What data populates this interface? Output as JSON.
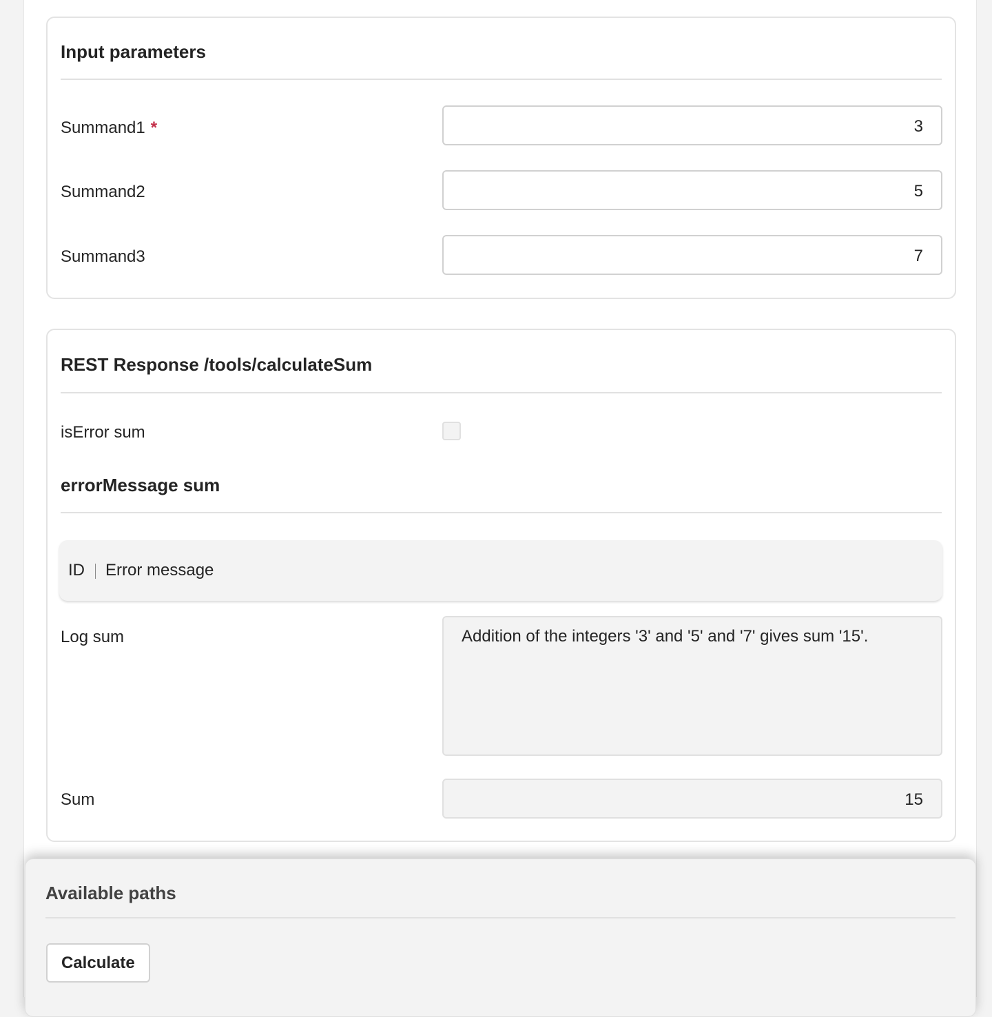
{
  "input_parameters": {
    "title": "Input parameters",
    "fields": [
      {
        "label": "Summand1",
        "required_mark": "*",
        "value": "3"
      },
      {
        "label": "Summand2",
        "value": "5"
      },
      {
        "label": "Summand3",
        "value": "7"
      }
    ]
  },
  "rest_response": {
    "title": "REST Response /tools/calculateSum",
    "is_error_label": "isError sum",
    "is_error_checked": false,
    "error_message_title": "errorMessage sum",
    "error_table": {
      "columns": [
        "ID",
        "Error message"
      ]
    },
    "log_label": "Log sum",
    "log_value": "Addition of the integers '3' and '5' and '7' gives sum '15'.",
    "sum_label": "Sum",
    "sum_value": "15"
  },
  "footer": {
    "title": "Available paths",
    "calculate_label": "Calculate"
  }
}
